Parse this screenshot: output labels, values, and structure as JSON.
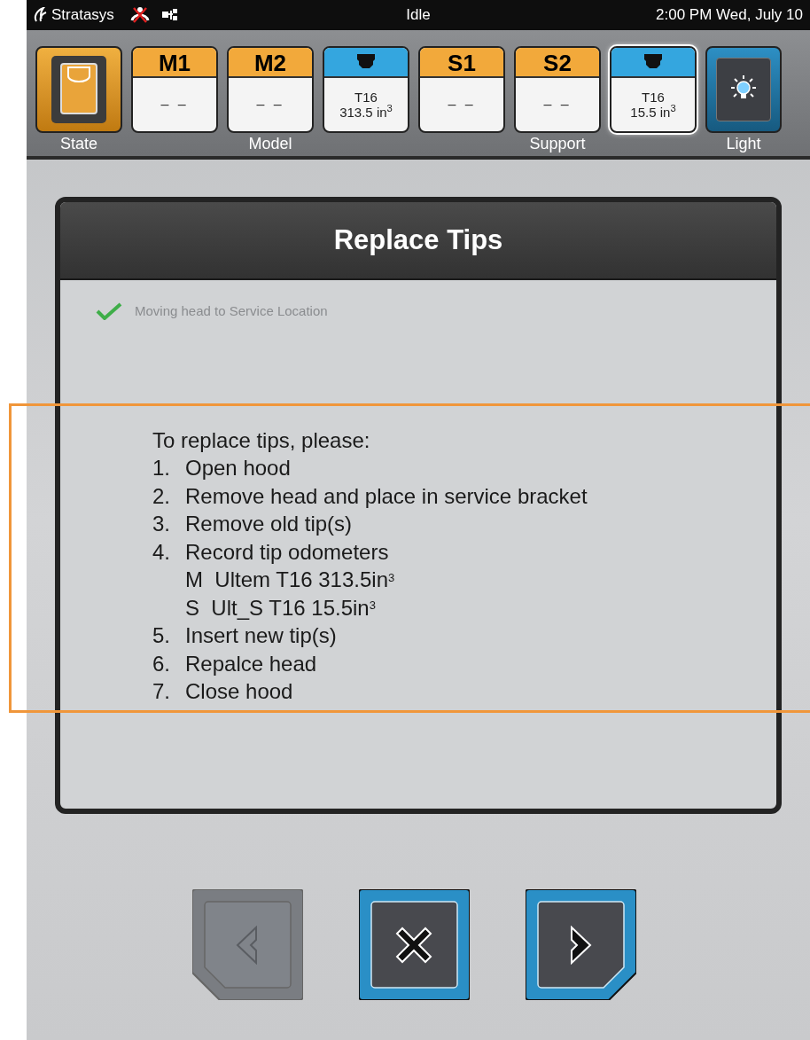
{
  "status_bar": {
    "brand": "Stratasys",
    "status": "Idle",
    "datetime": "2:00 PM Wed, July 10"
  },
  "toolbar": {
    "groups": [
      {
        "label": "State",
        "slots": [
          {
            "kind": "state",
            "selected": false
          }
        ]
      },
      {
        "label": "Model",
        "slots": [
          {
            "kind": "material",
            "name": "M1",
            "value": "– –",
            "selected": false
          },
          {
            "kind": "material",
            "name": "M2",
            "value": "– –",
            "selected": false
          },
          {
            "kind": "tip",
            "lines": [
              "T16",
              "313.5 in$^{3}$"
            ],
            "selected": false
          }
        ]
      },
      {
        "label": "Support",
        "slots": [
          {
            "kind": "material",
            "name": "S1",
            "value": "– –",
            "selected": false
          },
          {
            "kind": "material",
            "name": "S2",
            "value": "– –",
            "selected": false
          },
          {
            "kind": "tip",
            "lines": [
              "T16",
              "15.5 in$^{3}$"
            ],
            "selected": true
          }
        ]
      },
      {
        "label": "Light",
        "slots": [
          {
            "kind": "light",
            "selected": false
          }
        ]
      }
    ]
  },
  "dialog": {
    "title": "Replace Tips",
    "progress": [
      {
        "text": "Moving head to Service Location",
        "done": true
      }
    ],
    "intro": "To replace tips, please:",
    "steps": [
      {
        "number": "1.",
        "text": "Open hood"
      },
      {
        "number": "2.",
        "text": "Remove head and place in service bracket"
      },
      {
        "number": "3.",
        "text": "Remove old tip(s)"
      },
      {
        "number": "4.",
        "text": "Record tip odometers",
        "children": [
          {
            "text": "M  Ultem T16 313.5in$^{3}$"
          },
          {
            "text": "S  Ult_S T16 15.5in$^{3}$"
          }
        ]
      },
      {
        "number": "5.",
        "text": "Insert new tip(s)"
      },
      {
        "number": "6.",
        "text": "Repalce head"
      },
      {
        "number": "7.",
        "text": "Close hood"
      }
    ]
  },
  "nav_buttons": [
    {
      "kind": "back",
      "disabled": true
    },
    {
      "kind": "cancel",
      "disabled": false
    },
    {
      "kind": "next",
      "disabled": false
    }
  ]
}
